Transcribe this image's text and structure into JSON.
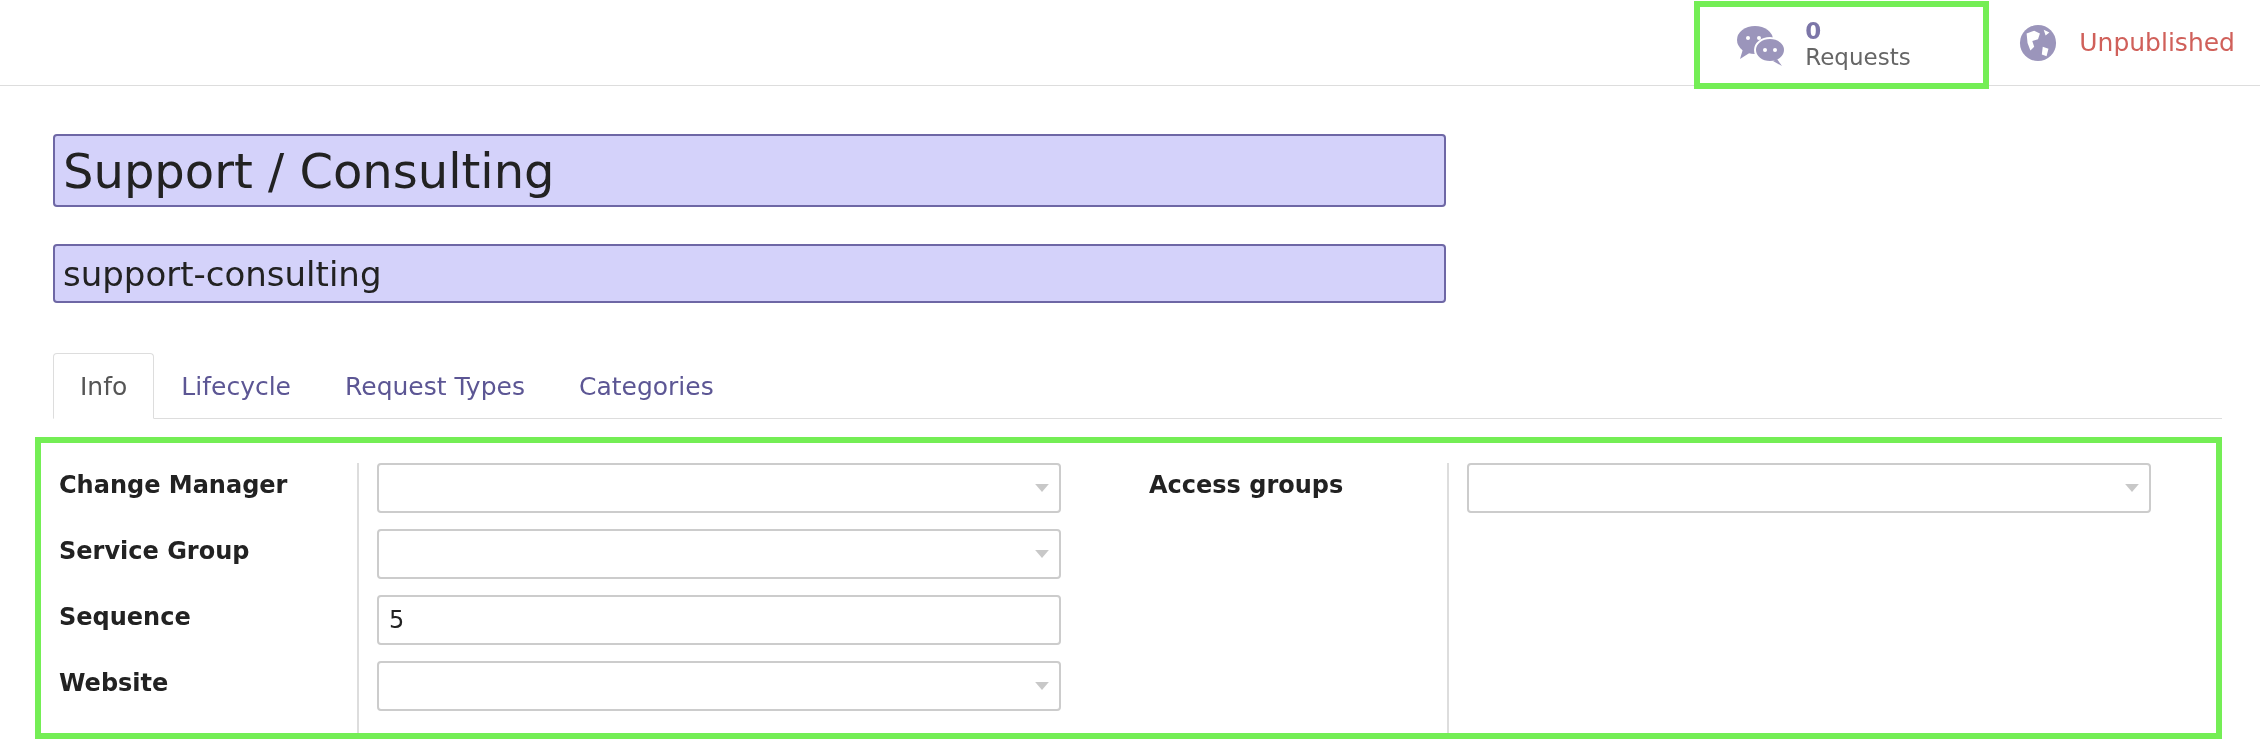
{
  "header": {
    "requests_button": {
      "count": "0",
      "label": "Requests",
      "highlighted": true
    },
    "publish_status": {
      "label": "Unpublished",
      "published": false
    }
  },
  "title_field": {
    "value": "Support / Consulting"
  },
  "slug_field": {
    "value": "support-consulting"
  },
  "tabs": [
    {
      "label": "Info",
      "selected": true
    },
    {
      "label": "Lifecycle",
      "selected": false
    },
    {
      "label": "Request Types",
      "selected": false
    },
    {
      "label": "Categories",
      "selected": false
    }
  ],
  "info_panel": {
    "highlighted": true,
    "left_fields": [
      {
        "label": "Change Manager",
        "kind": "select"
      },
      {
        "label": "Service Group",
        "kind": "select"
      },
      {
        "label": "Sequence",
        "kind": "text",
        "value": "5"
      },
      {
        "label": "Website",
        "kind": "select"
      }
    ],
    "right_fields": [
      {
        "label": "Access groups",
        "kind": "select"
      }
    ]
  }
}
